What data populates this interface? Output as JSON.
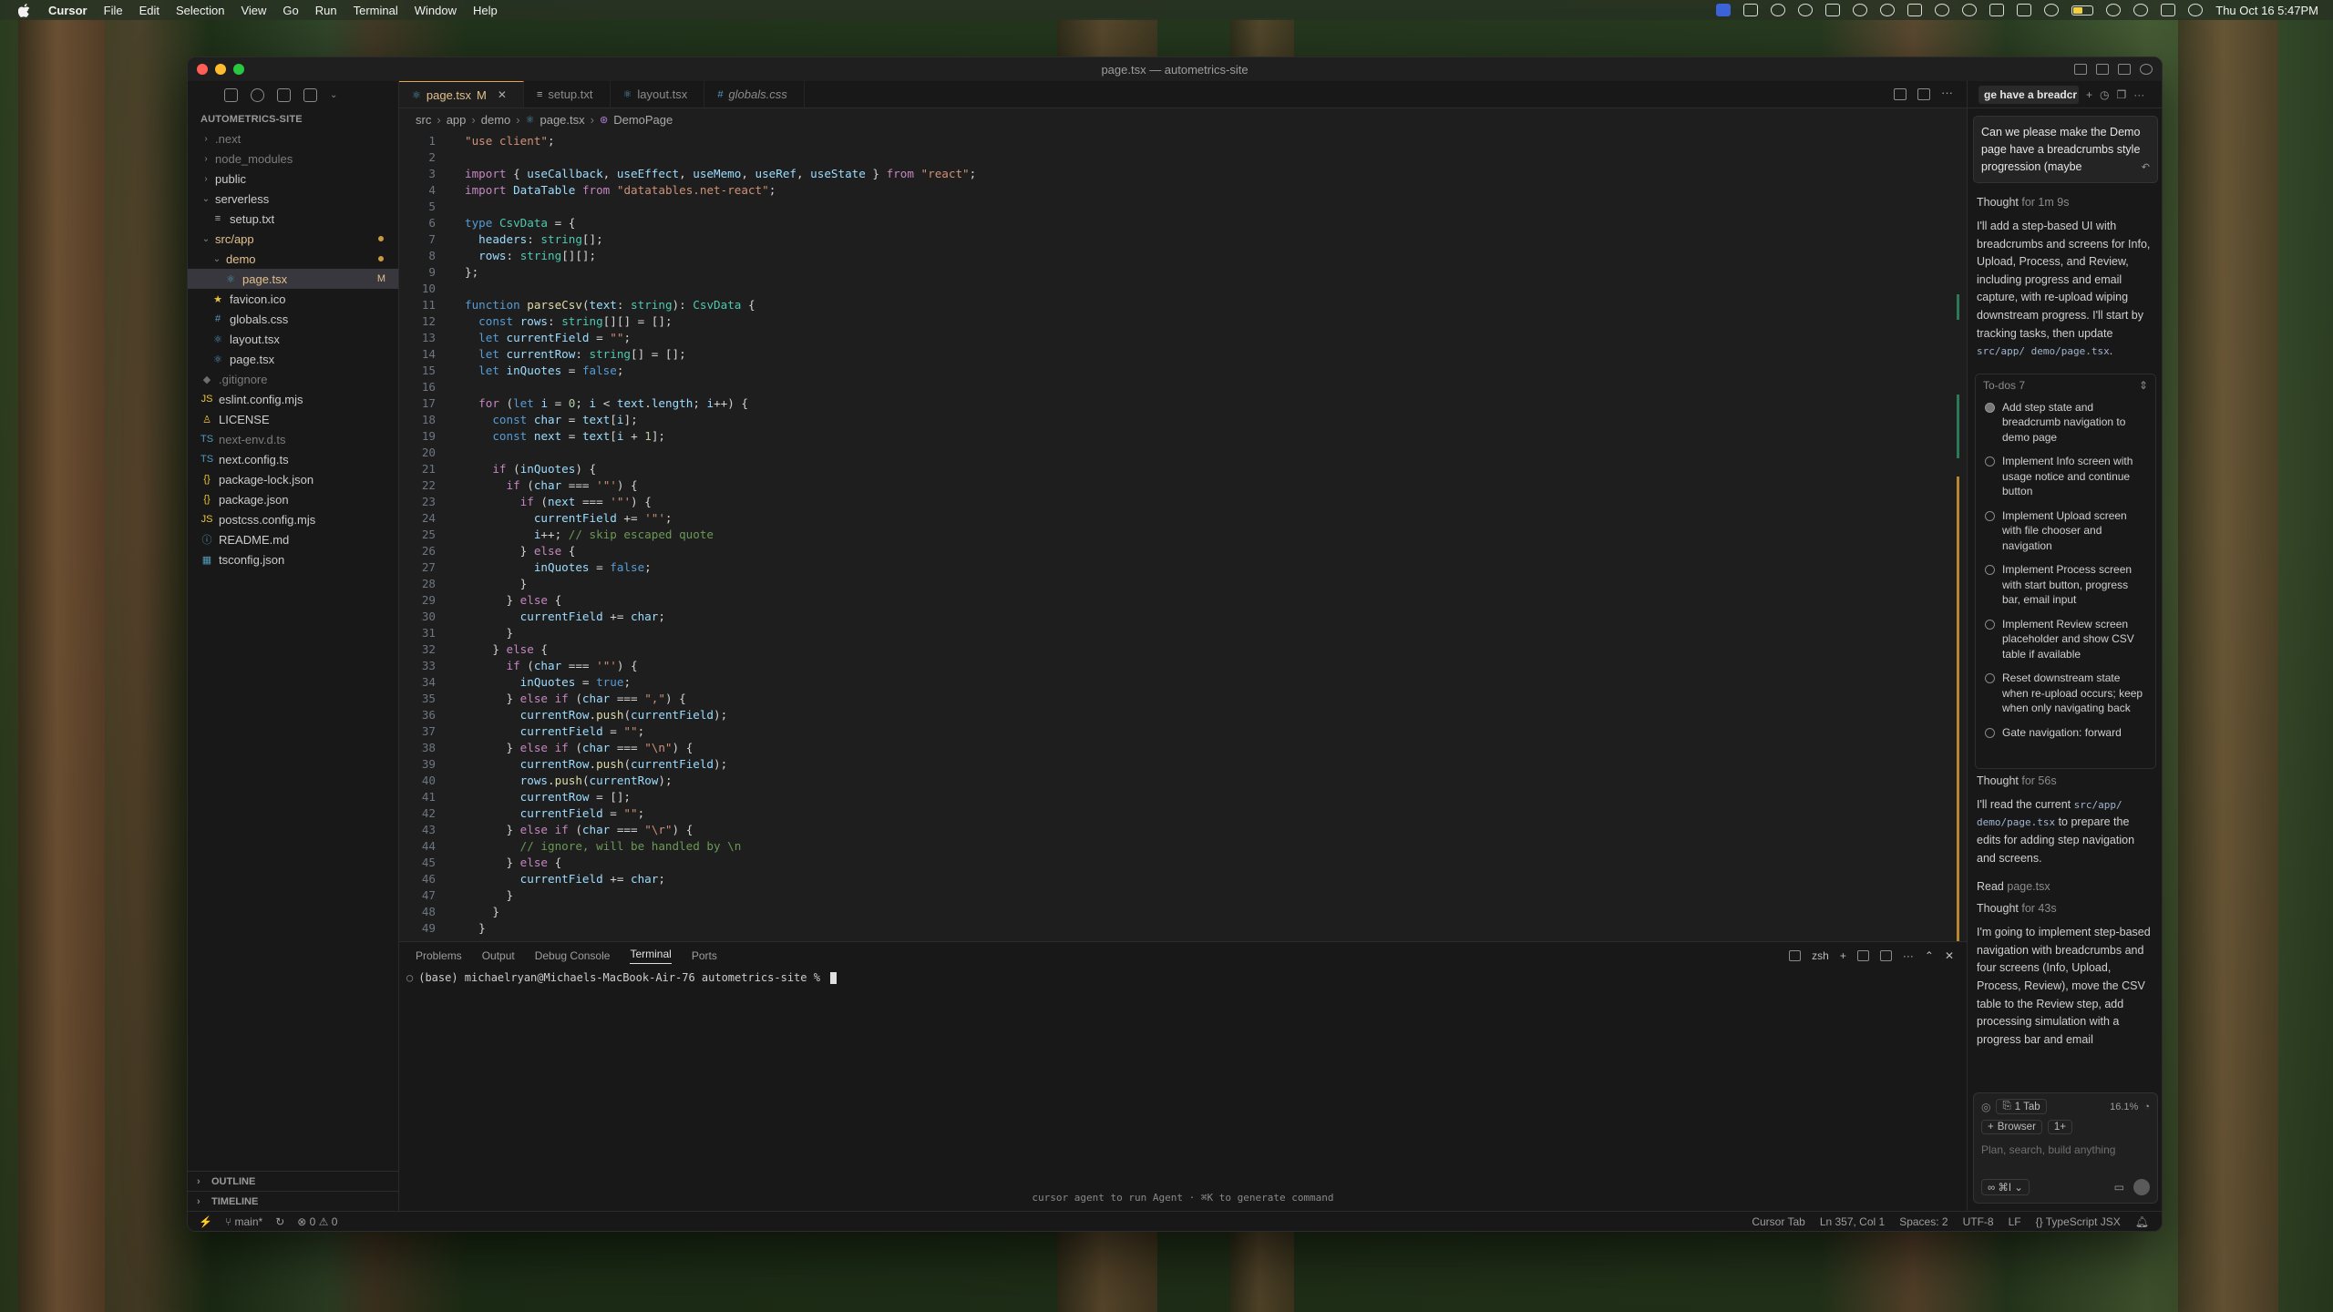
{
  "menubar": {
    "app": "Cursor",
    "items": [
      "File",
      "Edit",
      "Selection",
      "View",
      "Go",
      "Run",
      "Terminal",
      "Window",
      "Help"
    ],
    "datetime": "Thu Oct 16  5:47PM"
  },
  "window": {
    "title": "page.tsx — autometrics-site"
  },
  "explorer": {
    "header": "AUTOMETRICS-SITE",
    "items": [
      {
        "label": ".next",
        "kind": "folder"
      },
      {
        "label": "node_modules",
        "kind": "folder"
      },
      {
        "label": "public",
        "kind": "folder"
      },
      {
        "label": "serverless",
        "kind": "folder-open"
      },
      {
        "label": "setup.txt",
        "kind": "file"
      },
      {
        "label": "src/app",
        "kind": "folder-open"
      },
      {
        "label": "demo",
        "kind": "folder-open"
      },
      {
        "label": "page.tsx",
        "kind": "file",
        "badge": "M"
      },
      {
        "label": "favicon.ico",
        "kind": "file"
      },
      {
        "label": "globals.css",
        "kind": "file"
      },
      {
        "label": "layout.tsx",
        "kind": "file"
      },
      {
        "label": "page.tsx",
        "kind": "file"
      },
      {
        "label": ".gitignore",
        "kind": "file"
      },
      {
        "label": "eslint.config.mjs",
        "kind": "file"
      },
      {
        "label": "LICENSE",
        "kind": "file"
      },
      {
        "label": "next-env.d.ts",
        "kind": "file"
      },
      {
        "label": "next.config.ts",
        "kind": "file"
      },
      {
        "label": "package-lock.json",
        "kind": "file"
      },
      {
        "label": "package.json",
        "kind": "file"
      },
      {
        "label": "postcss.config.mjs",
        "kind": "file"
      },
      {
        "label": "README.md",
        "kind": "file"
      },
      {
        "label": "tsconfig.json",
        "kind": "file"
      }
    ],
    "outline": "OUTLINE",
    "timeline": "TIMELINE"
  },
  "tabs": [
    {
      "label": "page.tsx",
      "badge": "M"
    },
    {
      "label": "setup.txt"
    },
    {
      "label": "layout.tsx"
    },
    {
      "label": "globals.css"
    }
  ],
  "breadcrumb": [
    "src",
    "app",
    "demo",
    "page.tsx",
    "DemoPage"
  ],
  "code": {
    "line_numbers": [
      "1",
      "2",
      "3",
      "4",
      "5",
      "6",
      "7",
      "8",
      "9",
      "10",
      "11",
      "12",
      "13",
      "14",
      "15",
      "16",
      "17",
      "18",
      "19",
      "20",
      "21",
      "22",
      "23",
      "24",
      "25",
      "26",
      "27",
      "28",
      "29",
      "30",
      "31",
      "32",
      "33",
      "34",
      "35",
      "36",
      "37",
      "38",
      "39",
      "40",
      "41",
      "42",
      "43",
      "44",
      "45",
      "46",
      "47",
      "48",
      "49"
    ]
  },
  "panel": {
    "tabs": [
      "Problems",
      "Output",
      "Debug Console",
      "Terminal",
      "Ports"
    ],
    "shell": "zsh",
    "prompt": "(base) michaelryan@Michaels-MacBook-Air-76 autometrics-site % ",
    "hint": "cursor agent to run Agent · ⌘K to generate command"
  },
  "status": {
    "branch": "main*",
    "problems": "⊗ 0 ⚠ 0",
    "cursor_tab": "Cursor Tab",
    "position": "Ln 357, Col 1",
    "spaces": "Spaces: 2",
    "encoding": "UTF-8",
    "eol": "LF",
    "language": "TypeScript JSX"
  },
  "chat": {
    "tab_title": "ge have a breadcr",
    "user_message": "Can we please make the Demo page have a breadcrumbs style progression (maybe",
    "thought1": {
      "label": "Thought",
      "dur": "for 1m 9s"
    },
    "para1": "I'll add a step-based UI with breadcrumbs and screens for Info, Upload, Process, and Review, including progress and email capture, with re-upload wiping downstream progress. I'll start by tracking tasks, then update",
    "para1_code": "src/app/ demo/page.tsx",
    "todos_header": "To-dos 7",
    "todos": [
      "Add step state and breadcrumb navigation to demo page",
      "Implement Info screen with usage notice and continue button",
      "Implement Upload screen with file chooser and navigation",
      "Implement Process screen with start button, progress bar, email input",
      "Implement Review screen placeholder and show CSV table if available",
      "Reset downstream state when re-upload occurs; keep when only navigating back",
      "Gate navigation: forward"
    ],
    "thought2": {
      "label": "Thought",
      "dur": "for 56s"
    },
    "para2a": "I'll read the current",
    "para2_code": "src/app/ demo/page.tsx",
    "para2b": "to prepare the edits for adding step navigation and screens.",
    "read": {
      "label": "Read",
      "file": "page.tsx"
    },
    "thought3": {
      "label": "Thought",
      "dur": "for 43s"
    },
    "para3": "I'm going to implement step-based navigation with breadcrumbs and four screens (Info, Upload, Process, Review), move the CSV table to the Review step, add processing simulation with a progress bar and email",
    "composer": {
      "tab_chip": "1 Tab",
      "usage": "16.1%",
      "browser_chip": "Browser",
      "count_chip": "1+",
      "placeholder": "Plan, search, build anything",
      "mode": "∞ ⌘I ⌄"
    }
  }
}
